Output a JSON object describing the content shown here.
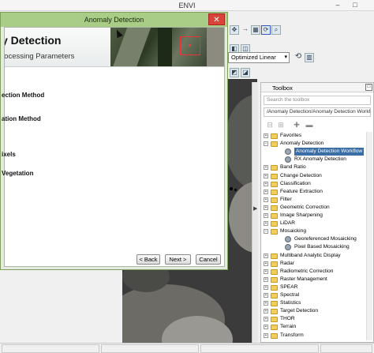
{
  "app": {
    "title": "ENVI",
    "window_controls": [
      "–",
      "□"
    ],
    "stretch_value": "Optimized Linear"
  },
  "dialog": {
    "title": "Anomaly Detection",
    "close_glyph": "✕",
    "banner_title": "y Detection",
    "banner_subtitle": "rocessing Parameters",
    "steps": [
      "ection Method",
      "ation Method",
      "ixels",
      "Vegetation"
    ],
    "buttons": {
      "back": "< Back",
      "next": "Next >",
      "cancel": "Cancel"
    }
  },
  "toolbox": {
    "title": "Toolbox",
    "search_placeholder": "Search the toolbox",
    "path": "/Anomaly Detection/Anomaly Detection Workflo",
    "tree": [
      {
        "label": "Favorites",
        "level": 0,
        "type": "folder",
        "exp": "+"
      },
      {
        "label": "Anomaly Detection",
        "level": 0,
        "type": "folder",
        "exp": "−"
      },
      {
        "label": "Anomaly Detection Workflow",
        "level": 1,
        "type": "tool",
        "selected": true
      },
      {
        "label": "RX Anomaly Detection",
        "level": 1,
        "type": "tool"
      },
      {
        "label": "Band Ratio",
        "level": 0,
        "type": "folder",
        "exp": "+"
      },
      {
        "label": "Change Detection",
        "level": 0,
        "type": "folder",
        "exp": "+"
      },
      {
        "label": "Classification",
        "level": 0,
        "type": "folder",
        "exp": "+"
      },
      {
        "label": "Feature Extraction",
        "level": 0,
        "type": "folder",
        "exp": "+"
      },
      {
        "label": "Filter",
        "level": 0,
        "type": "folder",
        "exp": "+"
      },
      {
        "label": "Geometric Correction",
        "level": 0,
        "type": "folder",
        "exp": "+"
      },
      {
        "label": "Image Sharpening",
        "level": 0,
        "type": "folder",
        "exp": "+"
      },
      {
        "label": "LiDAR",
        "level": 0,
        "type": "folder",
        "exp": "+"
      },
      {
        "label": "Mosaicking",
        "level": 0,
        "type": "folder",
        "exp": "−"
      },
      {
        "label": "Georeferenced Mosaicking",
        "level": 1,
        "type": "tool"
      },
      {
        "label": "Pixel Based Mosaicking",
        "level": 1,
        "type": "tool"
      },
      {
        "label": "Multiband Analytic Display",
        "level": 0,
        "type": "folder",
        "exp": "+"
      },
      {
        "label": "Radar",
        "level": 0,
        "type": "folder",
        "exp": "+"
      },
      {
        "label": "Radiometric Correction",
        "level": 0,
        "type": "folder",
        "exp": "+"
      },
      {
        "label": "Raster Management",
        "level": 0,
        "type": "folder",
        "exp": "+"
      },
      {
        "label": "SPEAR",
        "level": 0,
        "type": "folder",
        "exp": "+"
      },
      {
        "label": "Spectral",
        "level": 0,
        "type": "folder",
        "exp": "+"
      },
      {
        "label": "Statistics",
        "level": 0,
        "type": "folder",
        "exp": "+"
      },
      {
        "label": "Target Detection",
        "level": 0,
        "type": "folder",
        "exp": "+"
      },
      {
        "label": "THOR",
        "level": 0,
        "type": "folder",
        "exp": "+"
      },
      {
        "label": "Terrain",
        "level": 0,
        "type": "folder",
        "exp": "+"
      },
      {
        "label": "Transform",
        "level": 0,
        "type": "folder",
        "exp": "+"
      }
    ]
  }
}
